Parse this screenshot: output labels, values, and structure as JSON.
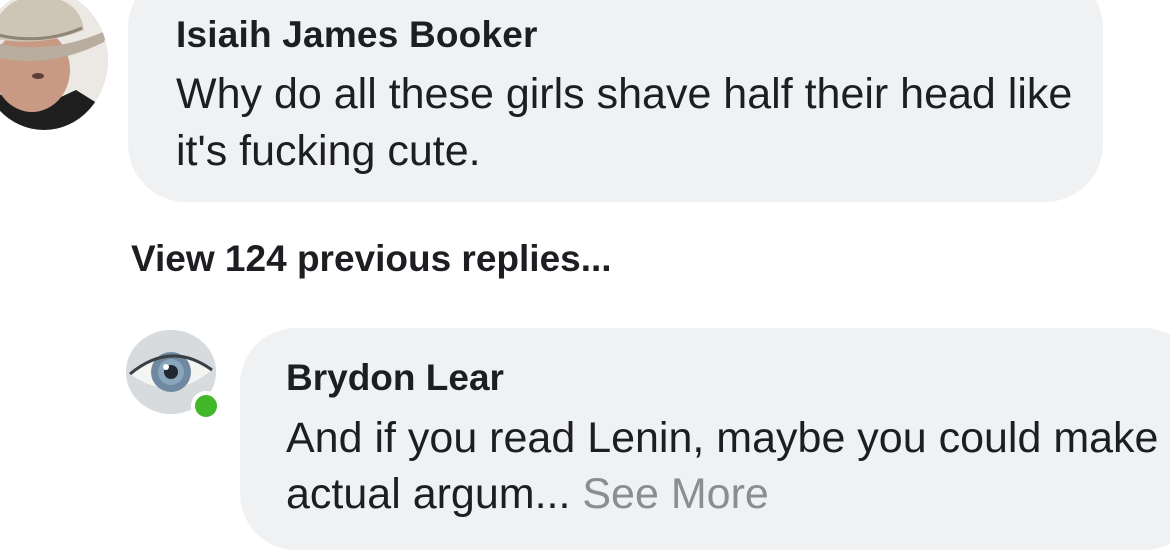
{
  "comments": [
    {
      "author": "Isiaih James Booker",
      "text": "Why do all these girls shave half their head like it's fucking cute.",
      "avatar_icon": "profile-photo-cowboy-hat"
    }
  ],
  "replies_link": "View 124 previous replies...",
  "reply": {
    "author": "Brydon Lear",
    "text": "And if you read Lenin, maybe you could make actual argum...",
    "see_more": "See More",
    "avatar_icon": "profile-photo-eye",
    "online": true
  },
  "colors": {
    "bubble": "#f0f1f3",
    "online": "#42b72a",
    "muted": "#8a8d91"
  }
}
